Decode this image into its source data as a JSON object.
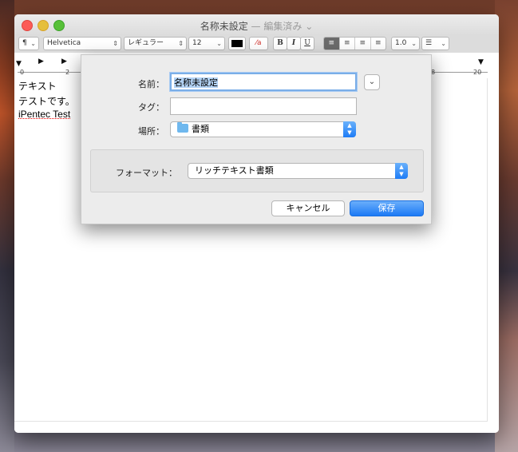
{
  "window": {
    "title": "名称未設定",
    "title_separator": " — ",
    "edited_label": "編集済み",
    "edited_chevron": "⌄"
  },
  "toolbar": {
    "paragraph_style": "¶",
    "font_family": "Helvetica",
    "font_style": "レギュラー",
    "font_size": "12",
    "bold_label": "B",
    "italic_label": "I",
    "underline_label": "U",
    "line_spacing": "1.0",
    "list_icon": "☰"
  },
  "ruler": {
    "numbers": [
      "0",
      "2",
      "8",
      "20"
    ]
  },
  "document": {
    "lines": [
      "テキスト",
      "テストです。",
      "iPentec Test"
    ]
  },
  "save_sheet": {
    "name_label": "名前：",
    "name_value": "名称未設定",
    "tags_label": "タグ：",
    "tags_value": "",
    "location_label": "場所：",
    "location_value": "書類",
    "format_label": "フォーマット：",
    "format_value": "リッチテキスト書類",
    "cancel_label": "キャンセル",
    "save_label": "保存"
  },
  "colors": {
    "accent": "#1c7af5",
    "selection": "#b3d3f5",
    "close": "#fc5b57",
    "minimize": "#e5bf3c",
    "maximize": "#57c038"
  }
}
